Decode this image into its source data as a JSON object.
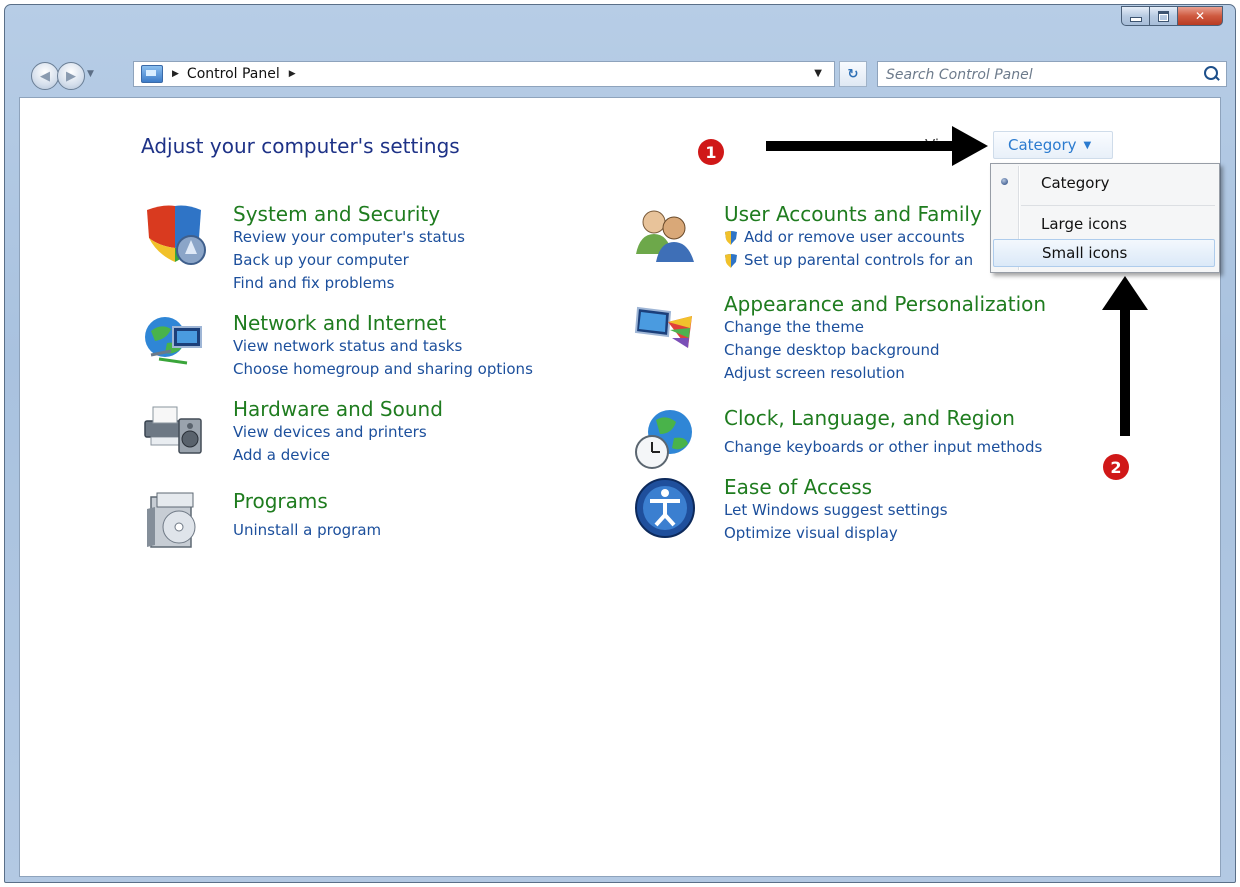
{
  "address_bar": {
    "crumbs": [
      "Control Panel"
    ]
  },
  "search": {
    "placeholder": "Search Control Panel"
  },
  "page": {
    "title": "Adjust your computer's settings",
    "view_by_label": "Vi",
    "view_by_value": "Category"
  },
  "view_menu": {
    "items": [
      {
        "label": "Category",
        "checked": true
      },
      {
        "label": "Large icons",
        "checked": false
      },
      {
        "label": "Small icons",
        "checked": false,
        "highlighted": true
      }
    ]
  },
  "categories_left": [
    {
      "title": "System and Security",
      "icon": "shield-icon",
      "tasks": [
        "Review your computer's status",
        "Back up your computer",
        "Find and fix problems"
      ]
    },
    {
      "title": "Network and Internet",
      "icon": "network-globe-icon",
      "tasks": [
        "View network status and tasks",
        "Choose homegroup and sharing options"
      ]
    },
    {
      "title": "Hardware and Sound",
      "icon": "printer-speaker-icon",
      "tasks": [
        "View devices and printers",
        "Add a device"
      ]
    },
    {
      "title": "Programs",
      "icon": "programs-disc-icon",
      "tasks": [
        "Uninstall a program"
      ]
    }
  ],
  "categories_right": [
    {
      "title": "User Accounts and Family",
      "icon": "users-icon",
      "tasks": [
        "Add or remove user accounts",
        "Set up parental controls for an"
      ]
    },
    {
      "title": "Appearance and Personalization",
      "icon": "monitor-palette-icon",
      "tasks": [
        "Change the theme",
        "Change desktop background",
        "Adjust screen resolution"
      ]
    },
    {
      "title": "Clock, Language, and Region",
      "icon": "clock-globe-icon",
      "tasks": [
        "Change keyboards or other input methods"
      ]
    },
    {
      "title": "Ease of Access",
      "icon": "ease-of-access-icon",
      "tasks": [
        "Let Windows suggest settings",
        "Optimize visual display"
      ]
    }
  ],
  "annotations": {
    "badge1": "1",
    "badge2": "2"
  },
  "colors": {
    "category_title": "#1f7c1f",
    "task_link": "#1c4f9c",
    "page_title": "#1e3287",
    "badge": "#d01818"
  }
}
